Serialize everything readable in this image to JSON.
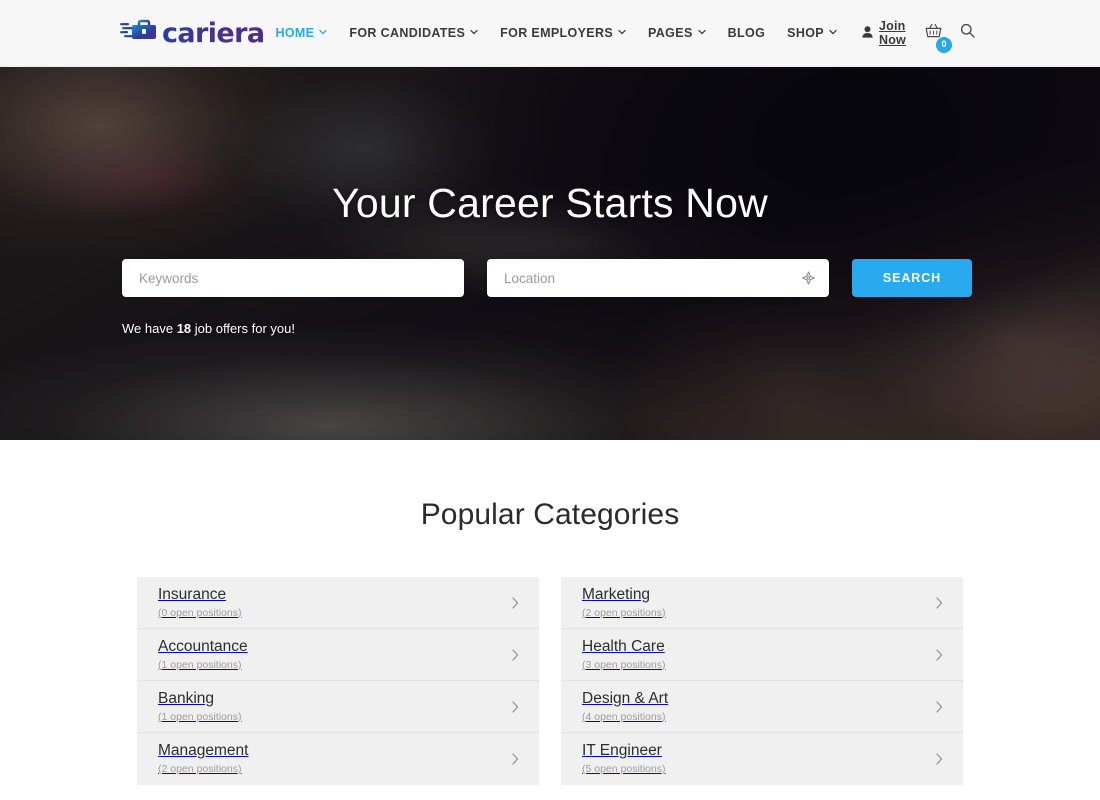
{
  "brand": {
    "name": "cariera",
    "logo_icon": "briefcase-speed-icon",
    "accent": "#27a9e3",
    "logo_gradient_from": "#2b3f9e",
    "logo_gradient_to": "#55288c"
  },
  "nav": {
    "items": [
      {
        "label": "HOME",
        "has_caret": true,
        "active": true
      },
      {
        "label": "FOR CANDIDATES",
        "has_caret": true,
        "active": false
      },
      {
        "label": "FOR EMPLOYERS",
        "has_caret": true,
        "active": false
      },
      {
        "label": "PAGES",
        "has_caret": true,
        "active": false
      },
      {
        "label": "BLOG",
        "has_caret": false,
        "active": false
      },
      {
        "label": "SHOP",
        "has_caret": true,
        "active": false
      }
    ],
    "join_label": "Join Now",
    "join_icon": "user-icon",
    "cart_icon": "shopping-basket-icon",
    "cart_count": "0",
    "search_icon": "search-icon"
  },
  "hero": {
    "title": "Your Career Starts Now",
    "keywords_placeholder": "Keywords",
    "keywords_value": "",
    "location_placeholder": "Location",
    "location_value": "",
    "geo_icon": "crosshair-locate-icon",
    "search_button": "SEARCH",
    "offers_prefix": "We have ",
    "offers_count": "18",
    "offers_suffix": " job offers for you!",
    "button_color": "#29aaf0"
  },
  "categories": {
    "title": "Popular Categories",
    "arrow_icon": "chevron-right-icon",
    "left": [
      {
        "name": "Insurance",
        "positions": "(0 open positions)"
      },
      {
        "name": "Accountance",
        "positions": "(1 open positions)"
      },
      {
        "name": "Banking",
        "positions": "(1 open positions)"
      },
      {
        "name": "Management",
        "positions": "(2 open positions)"
      }
    ],
    "right": [
      {
        "name": "Marketing",
        "positions": "(2 open positions)"
      },
      {
        "name": "Health Care",
        "positions": "(3 open positions)"
      },
      {
        "name": "Design & Art",
        "positions": "(4 open positions)"
      },
      {
        "name": "IT Engineer",
        "positions": "(5 open positions)"
      }
    ]
  }
}
